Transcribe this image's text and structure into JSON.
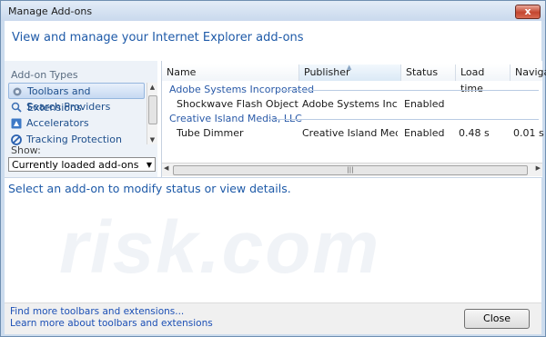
{
  "window": {
    "title": "Manage Add-ons",
    "close_glyph": "x"
  },
  "header": {
    "text": "View and manage your Internet Explorer add-ons"
  },
  "sidebar": {
    "title": "Add-on Types",
    "items": [
      {
        "label": "Toolbars and Extensions",
        "icon": "gear-icon"
      },
      {
        "label": "Search Providers",
        "icon": "search-icon"
      },
      {
        "label": "Accelerators",
        "icon": "accelerator-icon"
      },
      {
        "label": "Tracking Protection",
        "icon": "no-entry-icon"
      }
    ],
    "show_label": "Show:",
    "show_value": "Currently loaded add-ons"
  },
  "list": {
    "columns": [
      "Name",
      "Publisher",
      "Status",
      "Load time",
      "Navigatio"
    ],
    "groups": [
      {
        "name": "Adobe Systems Incorporated",
        "rows": [
          {
            "name": "Shockwave Flash Object",
            "publisher": "Adobe Systems Incorpor...",
            "status": "Enabled",
            "load_time": "",
            "navigation": ""
          }
        ]
      },
      {
        "name": "Creative Island Media, LLC",
        "rows": [
          {
            "name": "Tube Dimmer",
            "publisher": "Creative Island Media, L...",
            "status": "Enabled",
            "load_time": "0.48 s",
            "navigation": "0.01 s"
          }
        ]
      }
    ]
  },
  "status": {
    "text": "Select an add-on to modify status or view details."
  },
  "watermark": "risk.com",
  "footer": {
    "link1": "Find more toolbars and extensions...",
    "link2": "Learn more about toolbars and extensions",
    "close_label": "Close"
  },
  "colors": {
    "accent": "#1e5aa8",
    "link": "#1b4fb5",
    "selection": "#c6d9f2"
  }
}
